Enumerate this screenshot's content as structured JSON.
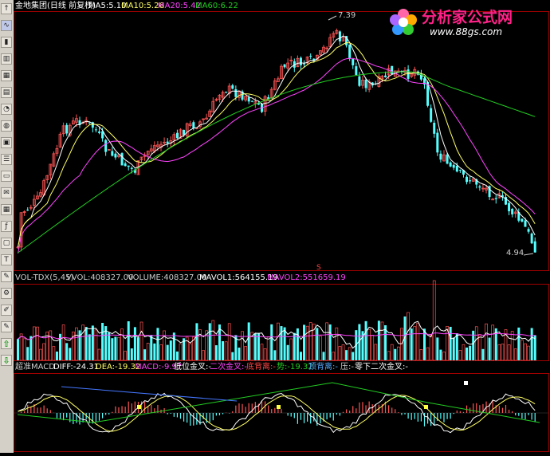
{
  "chart_title": "金地集团(日线 前复权)",
  "main_panel": {
    "ma5_label": "MA5:5.10",
    "ma10_label": "MA10:5.26",
    "ma20_label": "MA20:5.42",
    "ma60_label": "MA60:6.22",
    "high_marker": "7.39",
    "low_marker": "4.94",
    "s_marker": "S"
  },
  "volume_panel": {
    "indicator_name": "VOL-TDX(5,45)",
    "vvol_label": "VVOL:408327.00",
    "volume_label": "VOLUME:408327.00",
    "mavol1_label": "MAVOL1:564155.19",
    "mavol2_label": "MAVOL2:551659.19"
  },
  "macd_panel": {
    "indicator_name": "超准MACD",
    "diff_label": "DIFF:-24.31",
    "dea_label": "DEA:-19.32",
    "macd_label": "MACD:-9.97",
    "signal_1": "低位金叉:-",
    "signal_2": "二次金叉:-",
    "signal_3": "底背离:-",
    "signal_4": "势:-19.32",
    "signal_5": "顶背离:-",
    "signal_6": "压:-",
    "signal_7": "零下二次金叉:-"
  },
  "watermark": {
    "name": "分析家公式网",
    "url": "www.88gs.com"
  },
  "toolbar_icons": [
    "up-arrow-icon",
    "line-chart-icon",
    "candlestick-icon",
    "bar-chart-icon",
    "table-icon",
    "document-icon",
    "pie-chart-icon",
    "globe-icon",
    "calendar-icon",
    "list-icon",
    "window-icon",
    "message-icon",
    "grid-icon",
    "fx-icon",
    "rect-icon",
    "text-icon",
    "tools-icon",
    "settings-icon",
    "draw-icon",
    "pen-icon",
    "up-green-icon",
    "down-green-icon"
  ],
  "colors": {
    "up": "#ff5555",
    "down": "#55ffff",
    "ma5": "#ffffff",
    "ma10": "#ffff66",
    "ma20": "#ff44ff",
    "ma60": "#22cc22",
    "panel_border": "#a00000"
  }
}
